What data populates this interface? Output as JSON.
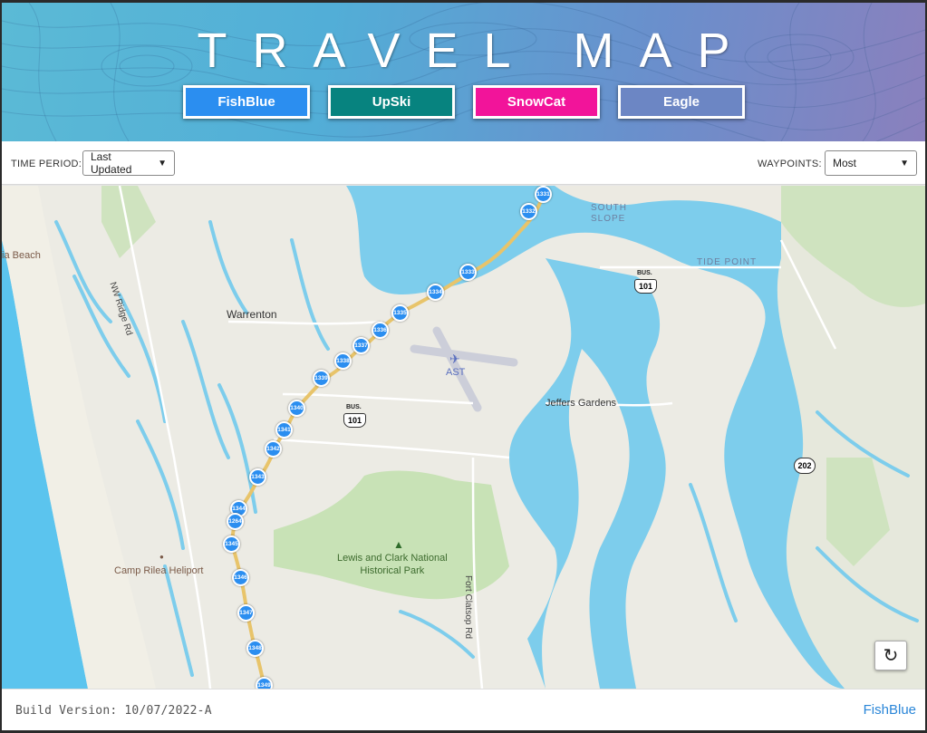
{
  "header": {
    "title": "TRAVEL MAP",
    "buttons": [
      {
        "label": "FishBlue",
        "color": "#2b8ef0"
      },
      {
        "label": "UpSki",
        "color": "#07837f"
      },
      {
        "label": "SnowCat",
        "color": "#f2149a"
      },
      {
        "label": "Eagle",
        "color": "#6c86c4"
      }
    ]
  },
  "controls": {
    "time_period_label": "TIME PERIOD:",
    "time_period_value": "Last Updated",
    "waypoints_label": "WAYPOINTS:",
    "waypoints_value": "Most"
  },
  "map": {
    "labels": {
      "warrenton": "Warrenton",
      "south_slope": "SOUTH\nSLOPE",
      "tide_point": "TIDE POINT",
      "jeffers_gardens": "Jeffers Gardens",
      "lewis_clark": "Lewis and Clark National\nHistorical Park",
      "camp_rilea": "Camp Rilea Heliport",
      "nw_ridge": "NW Ridge Rd",
      "fort_clatsop": "Fort Clatsop Rd",
      "beach": "ia Beach",
      "ast": "AST",
      "bus101_a": "101",
      "bus101_b": "101",
      "bus_tag": "BUS.",
      "hwy202": "202"
    },
    "waypoints": [
      "1331",
      "1332",
      "1333",
      "1334",
      "1335",
      "1336",
      "1337",
      "1338",
      "1339",
      "1340",
      "1341",
      "1342",
      "1343",
      "1344",
      "1264",
      "1345",
      "1346",
      "1347",
      "1348",
      "1349"
    ],
    "track_color": "#2b8ef0"
  },
  "footer": {
    "build_version": "Build Version: 10/07/2022-A",
    "link": "FishBlue"
  }
}
